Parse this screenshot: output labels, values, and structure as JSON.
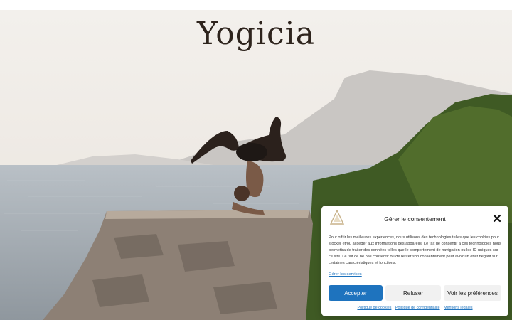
{
  "site": {
    "logo_text": "Yogicia"
  },
  "consent": {
    "title": "Gérer le consentement",
    "body": "Pour offrir les meilleures expériences, nous utilisons des technologies telles que les cookies pour stocker et/ou accéder aux informations des appareils. Le fait de consentir à ces technologies nous permettra de traiter des données telles que le comportement de navigation ou les ID uniques sur ce site. Le fait de ne pas consentir ou de retirer son consentement peut avoir un effet négatif sur certaines caractéristiques et fonctions.",
    "manage_link": "Gérer les services",
    "accept_label": "Accepter",
    "refuse_label": "Refuser",
    "prefs_label": "Voir les préférences",
    "links": [
      "Politique de cookies",
      "Politique de confidentialité",
      "Mentions légales"
    ],
    "accent_color": "#1e73be",
    "close_icon": "close-icon",
    "logo_icon": "brand-logo-icon"
  }
}
